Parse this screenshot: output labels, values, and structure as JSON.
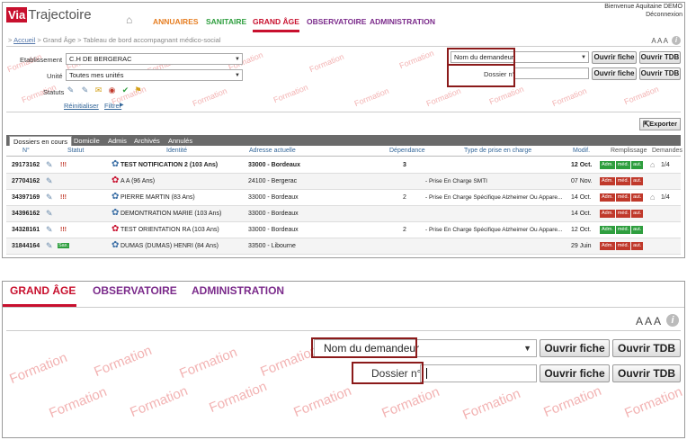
{
  "header": {
    "logo_via": "Via",
    "logo_traj": "Trajectoire",
    "user_line1": "Bienvenue Aquitaine DEMO",
    "user_line2": "Déconnexion",
    "nav": [
      "ANNUAIRES",
      "SANITAIRE",
      "GRAND ÂGE",
      "OBSERVATOIRE",
      "ADMINISTRATION"
    ],
    "nav_colors": [
      "#e67e22",
      "#2e9e3e",
      "#c8102e",
      "#7b2b8b",
      "#7b2b8b"
    ]
  },
  "breadcrumb": {
    "sep": ">",
    "home": "Accueil",
    "path": "> Grand Âge > Tableau de bord accompagnant médico-social"
  },
  "font_controls": "A A A",
  "watermark": "Formation",
  "filters": {
    "etab_label": "Etablissement",
    "etab_value": "C.H DE BERGERAC",
    "unite_label": "Unité",
    "unite_value": "Toutes mes unités",
    "statuts_label": "Statuts",
    "reset": "Réinitialiser",
    "filter": "Filtrer"
  },
  "search": {
    "demandeur_placeholder": "Nom du demandeur",
    "dossier_label": "Dossier n°",
    "open_file": "Ouvrir fiche",
    "open_tdb": "Ouvrir TDB"
  },
  "export": "Exporter",
  "tabs": [
    "Dossiers en cours",
    "Domicile",
    "Admis",
    "Archivés",
    "Annulés"
  ],
  "columns": [
    "N°",
    "Statut",
    "Identité",
    "Adresse actuelle",
    "Dépendance",
    "Type de prise en charge",
    "Modif.",
    "Remplissage",
    "Demandes"
  ],
  "fill_labels": [
    "Adm.",
    "méd.",
    "aut."
  ],
  "rows": [
    {
      "num": "29173162",
      "alert": "!!!",
      "name": "TEST NOTIFICATION 2 (103 Ans)",
      "addr": "33000 - Bordeaux",
      "dep": "3",
      "type": "",
      "mod": "12 Oct.",
      "fill": [
        "#2e9e3e",
        "#2e9e3e",
        "#2e9e3e"
      ],
      "dem": "1/4",
      "bold": true,
      "sex": "m"
    },
    {
      "num": "27704162",
      "alert": "",
      "name": "A A (96 Ans)",
      "addr": "24100 - Bergerac",
      "dep": "",
      "type": "- Prise En Charge SMTI",
      "mod": "07 Nov.",
      "fill": [
        "#c0392b",
        "#c0392b",
        "#c0392b"
      ],
      "dem": "",
      "bold": false,
      "sex": "f"
    },
    {
      "num": "34397169",
      "alert": "!!!",
      "name": "PIERRE MARTIN (83 Ans)",
      "addr": "33000 - Bordeaux",
      "dep": "2",
      "type": "- Prise En Charge Spécifique Alzheimer Ou Appare...",
      "mod": "14 Oct.",
      "fill": [
        "#c0392b",
        "#c0392b",
        "#c0392b"
      ],
      "dem": "1/4",
      "bold": false,
      "sex": "m"
    },
    {
      "num": "34396162",
      "alert": "",
      "name": "DEMONTRATION MARIE (103 Ans)",
      "addr": "33000 - Bordeaux",
      "dep": "",
      "type": "",
      "mod": "14 Oct.",
      "fill": [
        "#c0392b",
        "#c0392b",
        "#c0392b"
      ],
      "dem": "",
      "bold": false,
      "sex": "m"
    },
    {
      "num": "34328161",
      "alert": "!!!",
      "name": "TEST ORIENTATION RA (103 Ans)",
      "addr": "33000 - Bordeaux",
      "dep": "2",
      "type": "- Prise En Charge Spécifique Alzheimer Ou Appare...",
      "mod": "12 Oct.",
      "fill": [
        "#2e9e3e",
        "#2e9e3e",
        "#2e9e3e"
      ],
      "dem": "",
      "bold": false,
      "sex": "f"
    },
    {
      "num": "31844164",
      "alert": "Sax.",
      "name": "DUMAS (DUMAS) HENRI (84 Ans)",
      "addr": "33500 - Libourne",
      "dep": "",
      "type": "",
      "mod": "29 Juin",
      "fill": [
        "#c0392b",
        "#c0392b",
        "#c0392b"
      ],
      "dem": "",
      "bold": false,
      "sex": "m"
    }
  ]
}
